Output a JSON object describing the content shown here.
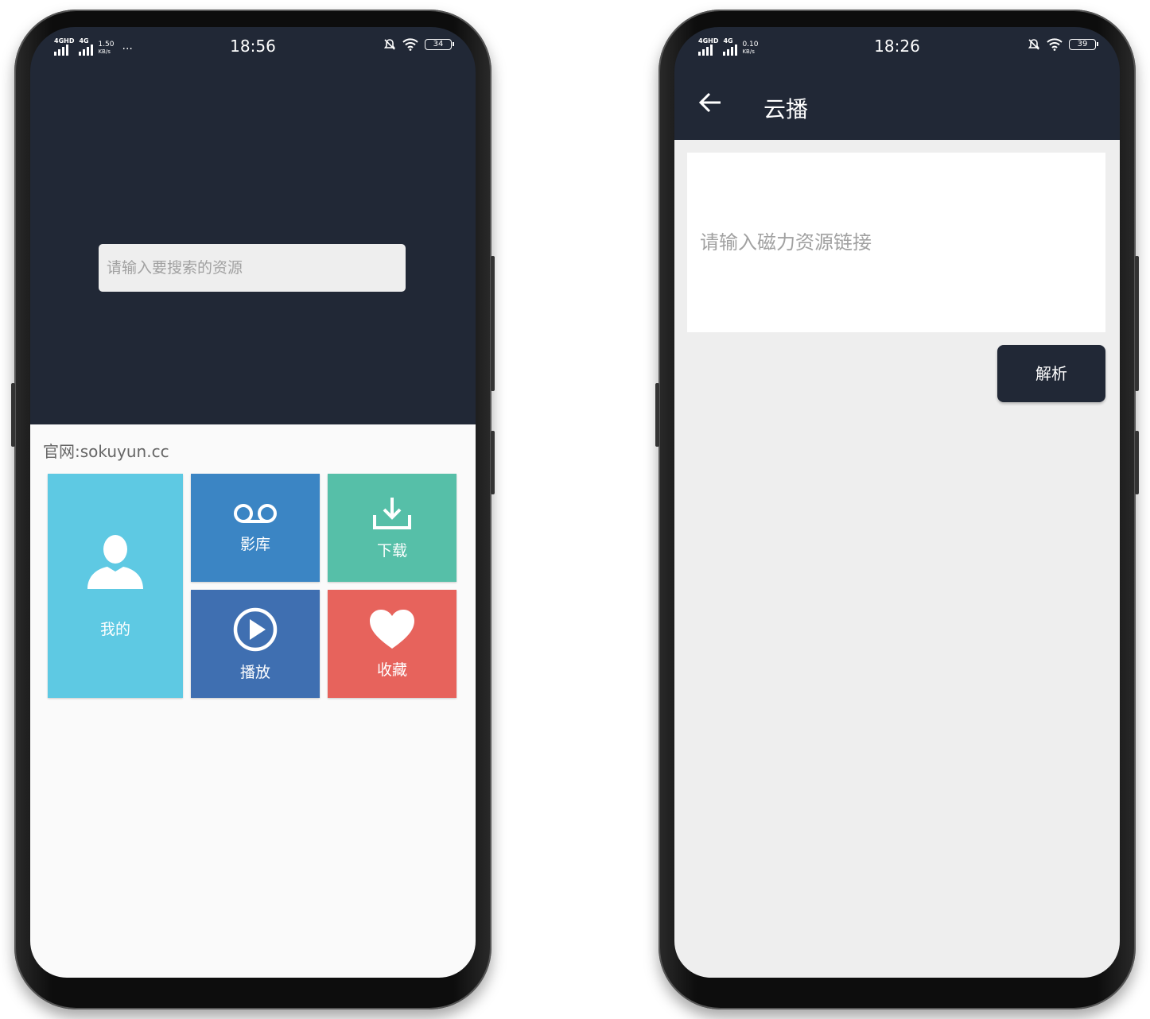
{
  "left_phone": {
    "status": {
      "net1": "4GHD",
      "net2": "4G",
      "speed_value": "1.50",
      "speed_unit": "KB/s",
      "more": "···",
      "time": "18:56",
      "battery": "34"
    },
    "search": {
      "placeholder": "请输入要搜索的资源"
    },
    "site_text": "官网:sokuyun.cc",
    "tiles": [
      {
        "label": "我的",
        "icon": "person-icon",
        "color": "#5ec9e3"
      },
      {
        "label": "影库",
        "icon": "voicemail-icon",
        "color": "#3b85c4"
      },
      {
        "label": "下载",
        "icon": "download-icon",
        "color": "#56bfa8"
      },
      {
        "label": "播放",
        "icon": "play-icon",
        "color": "#3f6fb1"
      },
      {
        "label": "收藏",
        "icon": "heart-icon",
        "color": "#e7635c"
      }
    ]
  },
  "right_phone": {
    "status": {
      "net1": "4GHD",
      "net2": "4G",
      "speed_value": "0.10",
      "speed_unit": "KB/s",
      "time": "18:26",
      "battery": "39"
    },
    "header": {
      "back_icon": "arrow-left-icon",
      "title": "云播"
    },
    "magnet": {
      "placeholder": "请输入磁力资源链接"
    },
    "parse_button": "解析"
  },
  "colors": {
    "dark": "#212836",
    "accent_light_bg": "#eeeeee"
  }
}
